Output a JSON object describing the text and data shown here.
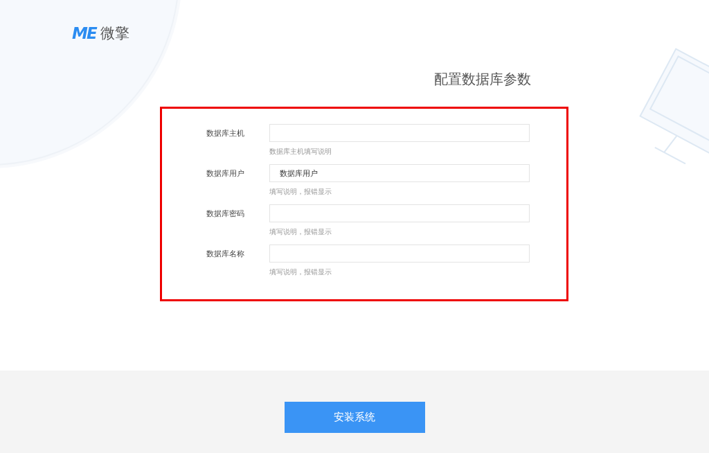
{
  "brand": {
    "logo": "ME",
    "name": "微擎"
  },
  "title": "配置数据库参数",
  "fields": [
    {
      "label": "数据库主机",
      "hint": "数据库主机填写说明"
    },
    {
      "label": "数据库用户",
      "value": "数据库用户",
      "hint": "填写说明，报错显示"
    },
    {
      "label": "数据库密码",
      "hint": "填写说明，报错显示"
    },
    {
      "label": "数据库名称",
      "hint": "填写说明，报错显示"
    }
  ],
  "submit": "安装系统"
}
